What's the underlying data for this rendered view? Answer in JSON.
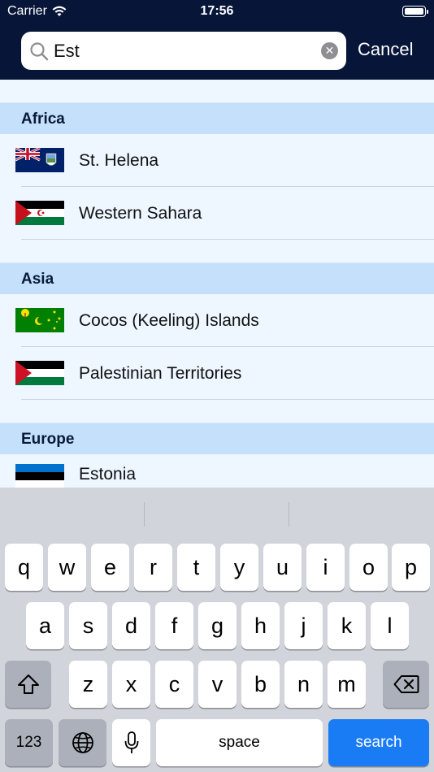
{
  "status_bar": {
    "carrier": "Carrier",
    "time": "17:56"
  },
  "search": {
    "value": "Est",
    "cancel_label": "Cancel"
  },
  "sections": [
    {
      "title": "Africa",
      "rows": [
        {
          "name": "St. Helena",
          "flag": "st-helena-flag"
        },
        {
          "name": "Western Sahara",
          "flag": "western-sahara-flag"
        }
      ]
    },
    {
      "title": "Asia",
      "rows": [
        {
          "name": "Cocos (Keeling) Islands",
          "flag": "cocos-islands-flag"
        },
        {
          "name": "Palestinian Territories",
          "flag": "palestine-flag"
        }
      ]
    },
    {
      "title": "Europe",
      "rows": [
        {
          "name": "Estonia",
          "flag": "estonia-flag"
        }
      ]
    }
  ],
  "keyboard": {
    "row1": [
      "q",
      "w",
      "e",
      "r",
      "t",
      "y",
      "u",
      "i",
      "o",
      "p"
    ],
    "row2": [
      "a",
      "s",
      "d",
      "f",
      "g",
      "h",
      "j",
      "k",
      "l"
    ],
    "row3": [
      "z",
      "x",
      "c",
      "v",
      "b",
      "n",
      "m"
    ],
    "numbers_label": "123",
    "space_label": "space",
    "search_label": "search"
  },
  "colors": {
    "header": "#071538",
    "list_bg": "#eef6ff",
    "section_header": "#c4e0fa",
    "search_key": "#1a7cf5"
  }
}
